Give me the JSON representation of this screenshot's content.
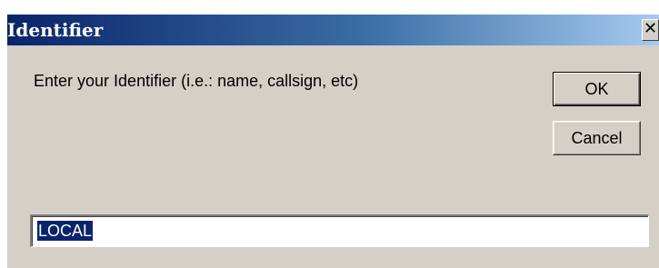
{
  "dialog": {
    "title": "Identifier",
    "close_glyph": "✕",
    "prompt": "Enter your Identifier (i.e.: name, callsign, etc)",
    "ok_label": "OK",
    "cancel_label": "Cancel",
    "input_value": "LOCAL",
    "input_selected": true
  },
  "colors": {
    "titlebar_start": "#0a246a",
    "titlebar_end": "#a6caf0",
    "face": "#d4d0c8",
    "selection": "#0a246a"
  }
}
